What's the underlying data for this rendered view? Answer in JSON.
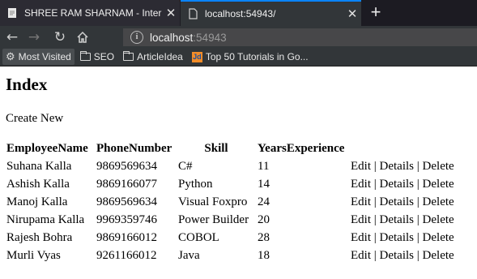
{
  "browser": {
    "tabs": [
      {
        "title": "SHREE RAM SHARNAM - Inter",
        "active": false
      },
      {
        "title": "localhost:54943/",
        "active": true
      }
    ],
    "new_tab_label": "+",
    "address": {
      "host": "localhost",
      "port": ":54943"
    },
    "bookmarks": [
      {
        "label": "Most Visited",
        "icon": "gear-icon"
      },
      {
        "label": "SEO",
        "icon": "folder-icon"
      },
      {
        "label": "ArticleIdea",
        "icon": "folder-icon"
      },
      {
        "label": "Top 50 Tutorials in Go...",
        "icon": "jd-site-icon"
      }
    ]
  },
  "page": {
    "title": "Index",
    "create_new": "Create New",
    "columns": [
      "EmployeeName",
      "PhoneNumber",
      "Skill",
      "YearsExperience",
      ""
    ],
    "rows": [
      {
        "name": "Suhana Kalla",
        "phone": "9869569634",
        "skill": "C#",
        "years": "11"
      },
      {
        "name": "Ashish Kalla",
        "phone": "9869166077",
        "skill": "Python",
        "years": "14"
      },
      {
        "name": "Manoj Kalla",
        "phone": "9869569634",
        "skill": "Visual Foxpro",
        "years": "24"
      },
      {
        "name": "Nirupama Kalla",
        "phone": "9969359746",
        "skill": "Power Builder",
        "years": "20"
      },
      {
        "name": "Rajesh Bohra",
        "phone": "9869166012",
        "skill": "COBOL",
        "years": "28"
      },
      {
        "name": "Murli Vyas",
        "phone": "9261166012",
        "skill": "Java",
        "years": "18"
      }
    ],
    "actions": {
      "edit": "Edit",
      "details": "Details",
      "delete": "Delete",
      "separator": " | "
    }
  }
}
